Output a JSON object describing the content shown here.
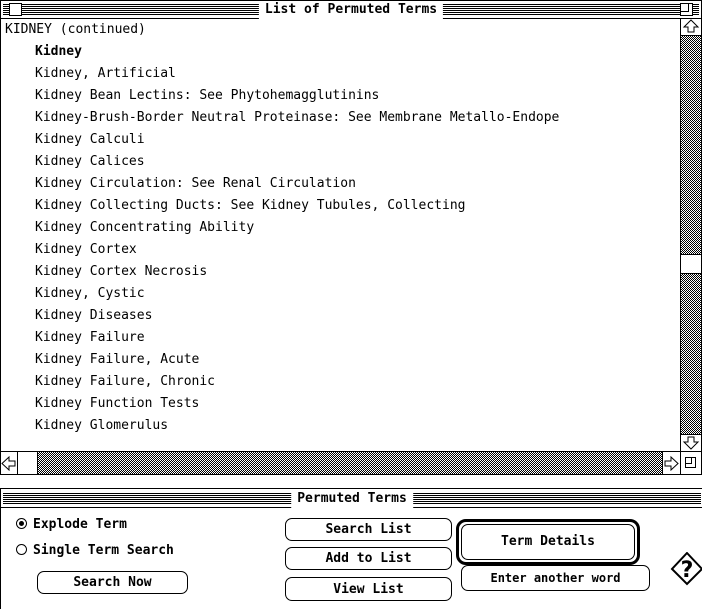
{
  "list_window": {
    "title": "List of Permuted Terms",
    "section_header": "KIDNEY (continued)",
    "terms": [
      {
        "label": "Kidney",
        "bold": true
      },
      {
        "label": "Kidney, Artificial"
      },
      {
        "label": "Kidney Bean Lectins: See Phytohemagglutinins"
      },
      {
        "label": "Kidney-Brush-Border Neutral Proteinase: See Membrane Metallo-Endope"
      },
      {
        "label": "Kidney Calculi"
      },
      {
        "label": "Kidney Calices"
      },
      {
        "label": "Kidney Circulation: See Renal Circulation"
      },
      {
        "label": "Kidney Collecting Ducts: See Kidney Tubules, Collecting"
      },
      {
        "label": "Kidney Concentrating Ability"
      },
      {
        "label": "Kidney Cortex"
      },
      {
        "label": "Kidney Cortex Necrosis"
      },
      {
        "label": "Kidney, Cystic"
      },
      {
        "label": "Kidney Diseases"
      },
      {
        "label": "Kidney Failure"
      },
      {
        "label": "Kidney Failure, Acute"
      },
      {
        "label": "Kidney Failure, Chronic"
      },
      {
        "label": "Kidney Function Tests"
      },
      {
        "label": "Kidney Glomerulus"
      }
    ],
    "icons": {
      "close": "close-box-icon",
      "zoom": "zoom-box-icon",
      "scroll_up": "up-arrow-icon",
      "scroll_down": "down-arrow-icon",
      "scroll_left": "left-arrow-icon",
      "scroll_right": "right-arrow-icon",
      "grow": "size-box-icon"
    }
  },
  "search_window": {
    "title": "Permuted Terms",
    "options": {
      "explode_term": {
        "label": "Explode Term",
        "selected": true
      },
      "single_term_search": {
        "label": "Single Term Search",
        "selected": false
      }
    },
    "buttons": {
      "search_now": "Search Now",
      "search_list": "Search List",
      "add_to_list": "Add to List",
      "view_list": "View List",
      "term_details": "Term Details",
      "enter_another_word": "Enter another word"
    },
    "help_icon": "help-diamond-icon"
  }
}
